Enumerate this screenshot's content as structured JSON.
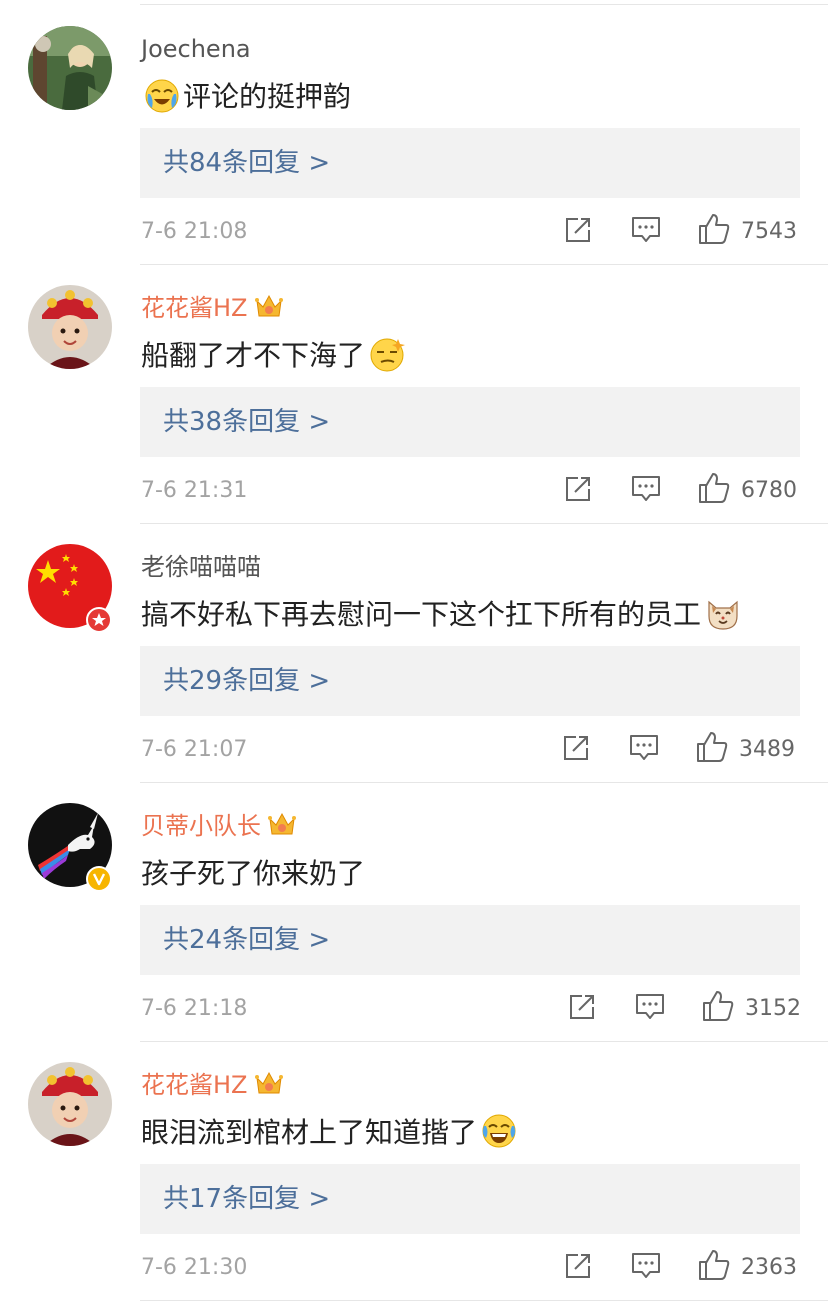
{
  "comments": [
    {
      "username": "Joechena",
      "name_style": "gray",
      "has_crown": false,
      "text_before": "",
      "emoji_before": "crying-laughing-emoji",
      "text": "评论的挺押韵",
      "emoji_after": "",
      "replies": "共84条回复 >",
      "date": "7-6 21:08",
      "likes": "7543",
      "avatar": "photo-woman-outdoor",
      "badge": ""
    },
    {
      "username": "花花酱HZ",
      "name_style": "orange",
      "has_crown": true,
      "emoji_before": "",
      "text": "船翻了才不下海了",
      "emoji_after": "smug-face-emoji",
      "replies": "共38条回复 >",
      "date": "7-6 21:31",
      "likes": "6780",
      "avatar": "child-red-headdress",
      "badge": ""
    },
    {
      "username": "老徐喵喵喵",
      "name_style": "gray",
      "has_crown": false,
      "emoji_before": "",
      "text": "搞不好私下再去慰问一下这个扛下所有的员工",
      "emoji_after": "cat-face-emoji",
      "replies": "共29条回复 >",
      "date": "7-6 21:07",
      "likes": "3489",
      "avatar": "china-flag",
      "badge": "red-star-badge"
    },
    {
      "username": "贝蒂小队长",
      "name_style": "orange",
      "has_crown": true,
      "emoji_before": "",
      "text": "孩子死了你来奶了",
      "emoji_after": "",
      "replies": "共24条回复 >",
      "date": "7-6 21:18",
      "likes": "3152",
      "avatar": "unicorn-dark",
      "badge": "verified-v-badge"
    },
    {
      "username": "花花酱HZ",
      "name_style": "orange",
      "has_crown": true,
      "emoji_before": "",
      "text": "眼泪流到棺材上了知道揩了",
      "emoji_after": "laughing-tears-emoji",
      "replies": "共17条回复 >",
      "date": "7-6 21:30",
      "likes": "2363",
      "avatar": "child-red-headdress",
      "badge": ""
    }
  ],
  "colors": {
    "username_orange": "#eb7350",
    "reply_link": "#4d6f9a",
    "reply_bg": "#f2f2f2",
    "meta_gray": "#a3a3a3"
  }
}
